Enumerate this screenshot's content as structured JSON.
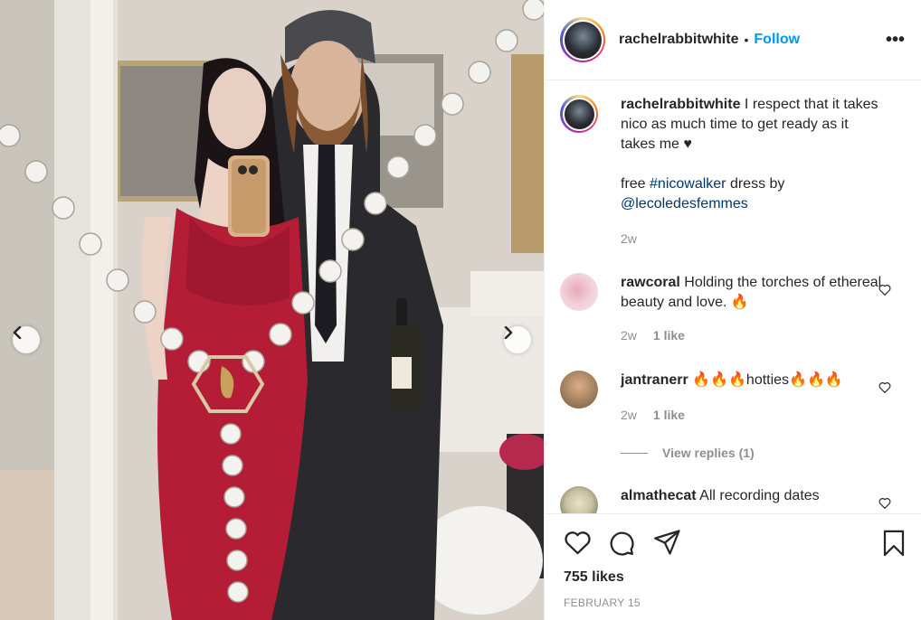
{
  "post": {
    "author": "rachelrabbitwhite",
    "separator": "•",
    "follow_label": "Follow",
    "more_label": "•••"
  },
  "caption": {
    "username": "rachelrabbitwhite",
    "text_1": " I respect that it takes nico as much time to get ready as it takes me ♥",
    "text_2": "free ",
    "hashtag": "#nicowalker",
    "text_3": " dress by",
    "mention": "@lecoledesfemmes",
    "time": "2w"
  },
  "comments": [
    {
      "username": "rawcoral",
      "text": " Holding the torches of ethereal beauty and love. 🔥",
      "time": "2w",
      "likes": "1 like"
    },
    {
      "username": "jantranerr",
      "text": " 🔥🔥🔥hotties🔥🔥🔥",
      "time": "2w",
      "likes": "1 like"
    },
    {
      "username": "almathecat",
      "text": " All recording dates"
    }
  ],
  "view_replies": "View replies (1)",
  "likes_count": "755 likes",
  "date": "FEBRUARY 15",
  "colors": {
    "follow": "#0095f6",
    "link": "#00376b",
    "secondary_text": "#8e8e8e",
    "border": "#efefef",
    "dress": "#b51c35"
  },
  "icons": {
    "like": "heart-icon",
    "comment": "comment-icon",
    "share": "paper-plane-icon",
    "save": "bookmark-icon",
    "carousel_prev": "chevron-left-icon",
    "carousel_next": "chevron-right-icon"
  }
}
